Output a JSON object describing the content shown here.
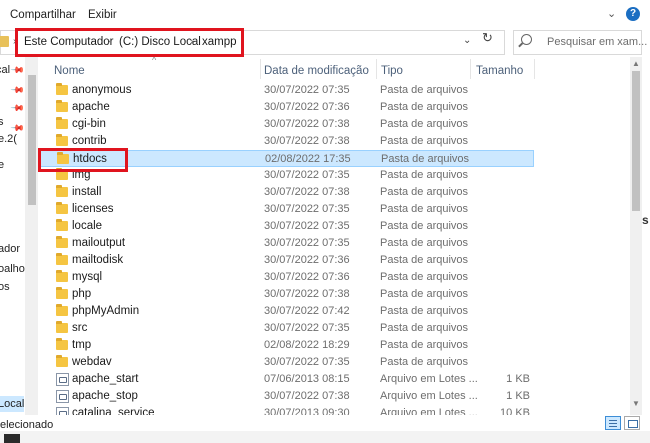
{
  "ribbon": {
    "tabs": [
      "Compartilhar",
      "Exibir"
    ],
    "help": "?"
  },
  "address": {
    "crumbs": [
      "Este Computador",
      "(C:) Disco Local",
      "xampp"
    ],
    "separator": "›"
  },
  "search": {
    "placeholder": "Pesquisar em xam..."
  },
  "nav": {
    "items": [
      "cal",
      "",
      "s",
      "e.2(",
      "e",
      "ador",
      "oalho",
      "os",
      "Local"
    ]
  },
  "columns": {
    "name": "Nome",
    "date": "Data de modificação",
    "type": "Tipo",
    "size": "Tamanho"
  },
  "rows": [
    {
      "name": "anonymous",
      "date": "30/07/2022 07:35",
      "type": "Pasta de arquivos",
      "size": "",
      "kind": "folder"
    },
    {
      "name": "apache",
      "date": "30/07/2022 07:36",
      "type": "Pasta de arquivos",
      "size": "",
      "kind": "folder"
    },
    {
      "name": "cgi-bin",
      "date": "30/07/2022 07:38",
      "type": "Pasta de arquivos",
      "size": "",
      "kind": "folder"
    },
    {
      "name": "contrib",
      "date": "30/07/2022 07:38",
      "type": "Pasta de arquivos",
      "size": "",
      "kind": "folder"
    },
    {
      "name": "htdocs",
      "date": "02/08/2022 17:35",
      "type": "Pasta de arquivos",
      "size": "",
      "kind": "folder",
      "selected": true
    },
    {
      "name": "img",
      "date": "30/07/2022 07:35",
      "type": "Pasta de arquivos",
      "size": "",
      "kind": "folder"
    },
    {
      "name": "install",
      "date": "30/07/2022 07:38",
      "type": "Pasta de arquivos",
      "size": "",
      "kind": "folder"
    },
    {
      "name": "licenses",
      "date": "30/07/2022 07:35",
      "type": "Pasta de arquivos",
      "size": "",
      "kind": "folder"
    },
    {
      "name": "locale",
      "date": "30/07/2022 07:35",
      "type": "Pasta de arquivos",
      "size": "",
      "kind": "folder"
    },
    {
      "name": "mailoutput",
      "date": "30/07/2022 07:35",
      "type": "Pasta de arquivos",
      "size": "",
      "kind": "folder"
    },
    {
      "name": "mailtodisk",
      "date": "30/07/2022 07:36",
      "type": "Pasta de arquivos",
      "size": "",
      "kind": "folder"
    },
    {
      "name": "mysql",
      "date": "30/07/2022 07:36",
      "type": "Pasta de arquivos",
      "size": "",
      "kind": "folder"
    },
    {
      "name": "php",
      "date": "30/07/2022 07:38",
      "type": "Pasta de arquivos",
      "size": "",
      "kind": "folder"
    },
    {
      "name": "phpMyAdmin",
      "date": "30/07/2022 07:42",
      "type": "Pasta de arquivos",
      "size": "",
      "kind": "folder"
    },
    {
      "name": "src",
      "date": "30/07/2022 07:35",
      "type": "Pasta de arquivos",
      "size": "",
      "kind": "folder"
    },
    {
      "name": "tmp",
      "date": "02/08/2022 18:29",
      "type": "Pasta de arquivos",
      "size": "",
      "kind": "folder"
    },
    {
      "name": "webdav",
      "date": "30/07/2022 07:35",
      "type": "Pasta de arquivos",
      "size": "",
      "kind": "folder"
    },
    {
      "name": "apache_start",
      "date": "07/06/2013 08:15",
      "type": "Arquivo em Lotes ...",
      "size": "1 KB",
      "kind": "file"
    },
    {
      "name": "apache_stop",
      "date": "30/07/2022 07:38",
      "type": "Arquivo em Lotes ...",
      "size": "1 KB",
      "kind": "file"
    },
    {
      "name": "catalina_service",
      "date": "30/07/2013 09:30",
      "type": "Arquivo em Lotes ...",
      "size": "10 KB",
      "kind": "file"
    }
  ],
  "status": {
    "text": "elecionado"
  },
  "colors": {
    "selection": "#cce8ff",
    "highlight": "#e0141e",
    "folder": "#f5c542"
  }
}
